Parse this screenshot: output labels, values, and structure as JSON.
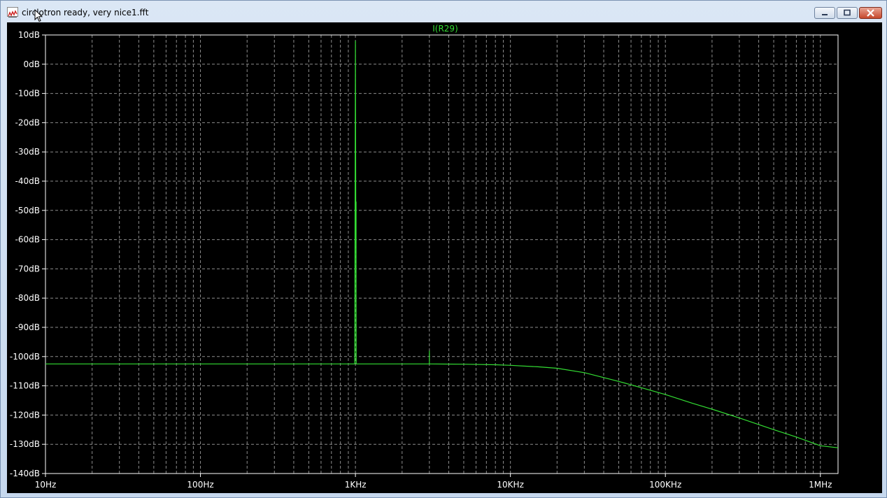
{
  "window": {
    "title": "circlotron ready, very nice1.fft"
  },
  "chart_data": {
    "type": "line",
    "title": "I(R29)",
    "xlabel": "",
    "ylabel": "",
    "x_scale": "log",
    "xlim": [
      10,
      1300000
    ],
    "ylim": [
      -140,
      10
    ],
    "grid": true,
    "x_ticks": [
      {
        "value": 10,
        "label": "10Hz"
      },
      {
        "value": 100,
        "label": "100Hz"
      },
      {
        "value": 1000,
        "label": "1KHz"
      },
      {
        "value": 10000,
        "label": "10KHz"
      },
      {
        "value": 100000,
        "label": "100KHz"
      },
      {
        "value": 1000000,
        "label": "1MHz"
      }
    ],
    "y_ticks": [
      {
        "value": 10,
        "label": "10dB"
      },
      {
        "value": 0,
        "label": "0dB"
      },
      {
        "value": -10,
        "label": "-10dB"
      },
      {
        "value": -20,
        "label": "-20dB"
      },
      {
        "value": -30,
        "label": "-30dB"
      },
      {
        "value": -40,
        "label": "-40dB"
      },
      {
        "value": -50,
        "label": "-50dB"
      },
      {
        "value": -60,
        "label": "-60dB"
      },
      {
        "value": -70,
        "label": "-70dB"
      },
      {
        "value": -80,
        "label": "-80dB"
      },
      {
        "value": -90,
        "label": "-90dB"
      },
      {
        "value": -100,
        "label": "-100dB"
      },
      {
        "value": -110,
        "label": "-110dB"
      },
      {
        "value": -120,
        "label": "-120dB"
      },
      {
        "value": -130,
        "label": "-130dB"
      },
      {
        "value": -140,
        "label": "-140dB"
      }
    ],
    "series": [
      {
        "name": "I(R29)",
        "color": "#33dd33",
        "x": [
          10,
          100,
          990,
          1000,
          1010,
          2000,
          3000,
          5000,
          8000,
          10000,
          15000,
          20000,
          30000,
          50000,
          80000,
          100000,
          150000,
          200000,
          300000,
          500000,
          700000,
          1000000,
          1300000
        ],
        "y": [
          -102.5,
          -102.5,
          -102.5,
          8,
          -102.5,
          -102.5,
          -102.5,
          -102.6,
          -102.8,
          -103,
          -103.5,
          -104,
          -105.5,
          -108.5,
          -111.5,
          -113,
          -116,
          -118,
          -121,
          -125,
          -127.5,
          -130.5,
          -131.2
        ]
      }
    ],
    "spurs": [
      {
        "x": 1010,
        "y": -47
      },
      {
        "x": 3000,
        "y": -98
      }
    ]
  }
}
